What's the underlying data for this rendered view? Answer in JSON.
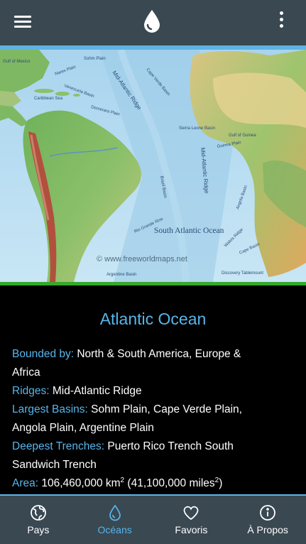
{
  "header": {
    "menu_icon": "hamburger-menu-icon",
    "logo_icon": "water-drop-icon",
    "overflow_icon": "more-vert-icon"
  },
  "map": {
    "labels": {
      "gulf_of_mexico": "Gulf of Mexico",
      "nares_plain": "Nares Plain",
      "sohm_plain": "Sohm Plain",
      "caribbean_sea": "Caribbean Sea",
      "venezuela_basin": "Venezuela Basin",
      "mid_atlantic_ridge": "Mid-Atlantic Ridge",
      "cape_verde_basin": "Cape Verde Basin",
      "demerara_plain": "Demerara Plain",
      "sierra_leone_basin": "Sierra Leone Basin",
      "gulf_of_guinea": "Gulf of Guinea",
      "guinea_plain": "Guinea Plain",
      "brazil_basin": "Brazil Basin",
      "angola_basin": "Angola Basin",
      "south_atlantic_ocean": "South Atlantic Ocean",
      "rio_grande_rise": "Rio Grande Rise",
      "walvis_ridge": "Walvis Ridge",
      "cape_basin": "Cape Basin",
      "argentine_basin": "Argentine Basin",
      "discovery_tablemount": "Discovery Tablemount"
    },
    "copyright": "© www.freeworldmaps.net"
  },
  "ocean": {
    "title": "Atlantic Ocean",
    "bounded_label": "Bounded by:",
    "bounded_value": "North & South America, Europe & Africa",
    "ridges_label": "Ridges:",
    "ridges_value": "Mid-Atlantic Ridge",
    "basins_label": "Largest Basins:",
    "basins_value": "Sohm Plain, Cape Verde Plain, Angola Plain, Argentine Plain",
    "trenches_label": "Deepest Trenches:",
    "trenches_value": "Puerto Rico Trench South Sandwich Trench",
    "area_label": "Area:",
    "area_km": "106,460,000 km",
    "area_km_exp": "2",
    "area_miles": "(41,100,000 miles",
    "area_miles_exp": "2",
    "area_close": ")"
  },
  "nav": {
    "items": [
      {
        "label": "Pays",
        "icon": "globe-icon"
      },
      {
        "label": "Océans",
        "icon": "water-drop-icon"
      },
      {
        "label": "Favoris",
        "icon": "heart-icon"
      },
      {
        "label": "À Propos",
        "icon": "info-icon"
      }
    ],
    "active_index": 1
  },
  "colors": {
    "app_bar": "#394851",
    "accent": "#57b5eb",
    "map_border": "#36a82a",
    "background": "#000000"
  }
}
